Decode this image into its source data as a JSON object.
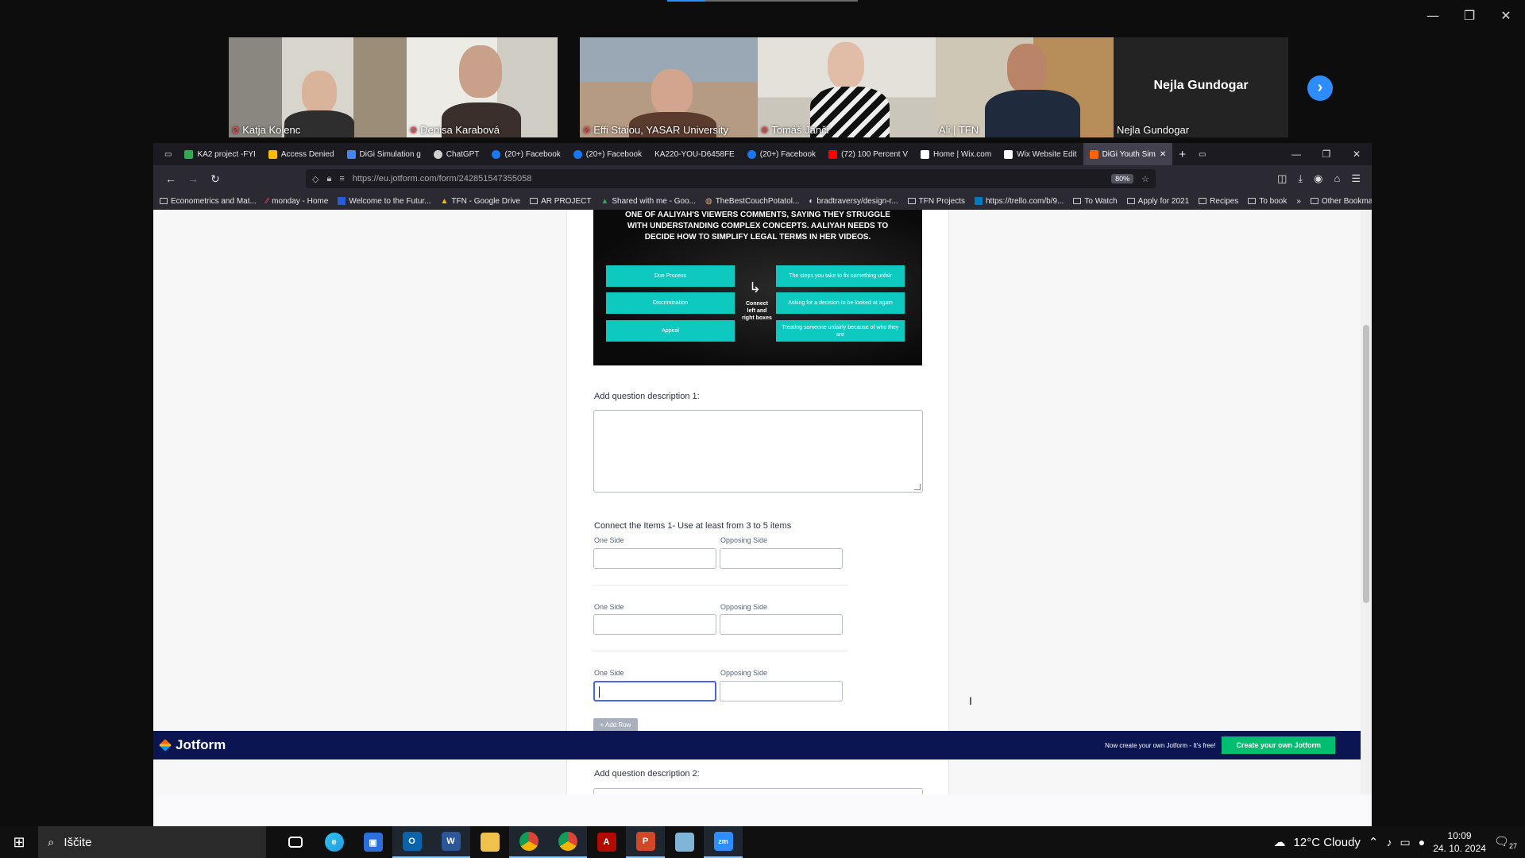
{
  "zoom": {
    "participants": [
      {
        "name": "Katja Kolenc",
        "muted": true
      },
      {
        "name": "Denisa Karabová",
        "muted": true
      },
      {
        "name": "Effi Staiou, YASAR University",
        "muted": true
      },
      {
        "name": "Tomáš Janči",
        "muted": true
      },
      {
        "name": "Ali | TFN",
        "muted": false,
        "active_speaker": true
      }
    ],
    "no_video_participant": {
      "display_name": "Nejla Gundogar",
      "label": "Nejla Gundogar"
    },
    "window_controls": {
      "minimize": "—",
      "restore": "❐",
      "close": "✕"
    }
  },
  "browser": {
    "tabs": [
      {
        "label": "KA2 project -FYI",
        "icon": "drive-icon",
        "color": "#34a853"
      },
      {
        "label": "Access Denied",
        "icon": "drive-icon",
        "color": "#fbbc04"
      },
      {
        "label": "DiGi Simulation g",
        "icon": "drive-icon",
        "color": "#4285f4"
      },
      {
        "label": "ChatGPT",
        "icon": "chatgpt-icon",
        "color": "#cfcfcf"
      },
      {
        "label": "(20+) Facebook",
        "icon": "facebook-icon",
        "color": "#1877f2"
      },
      {
        "label": "(20+) Facebook",
        "icon": "facebook-icon",
        "color": "#1877f2"
      },
      {
        "label": "KA220-YOU-D6458FE",
        "icon": "page-icon",
        "color": "#555555"
      },
      {
        "label": "(20+) Facebook",
        "icon": "facebook-icon",
        "color": "#1877f2"
      },
      {
        "label": "(72) 100 Percent V",
        "icon": "youtube-icon",
        "color": "#ff0000"
      },
      {
        "label": "Home | Wix.com",
        "icon": "wix-icon",
        "color": "#ffffff"
      },
      {
        "label": "Wix Website Edit",
        "icon": "wix-icon",
        "color": "#ffffff"
      },
      {
        "label": "DiGi Youth Sim",
        "icon": "jotform-icon",
        "color": "#ff6100",
        "active": true
      }
    ],
    "url": "https://eu.jotform.com/form/242851547355058",
    "zoom_level": "80%",
    "bookmarks": [
      "Econometrics and Mat...",
      "monday - Home",
      "Welcome to the Futur...",
      "TFN - Google Drive",
      "AR PROJECT",
      "Shared with me - Goo...",
      "TheBestCouchPotatol...",
      "bradtraversy/design-r...",
      "TFN Projects",
      "https://trello.com/b/9...",
      "To Watch",
      "Apply for 2021",
      "Recipes",
      "To book"
    ],
    "other_bookmarks": "Other Bookmarks"
  },
  "form": {
    "hero": {
      "text": "ONE OF AALIYAH'S VIEWERS COMMENTS, SAYING THEY STRUGGLE WITH UNDERSTANDING COMPLEX CONCEPTS. AALIYAH NEEDS TO DECIDE HOW TO SIMPLIFY LEGAL TERMS IN HER VIDEOS.",
      "left": [
        "Due Process",
        "Discrimination",
        "Appeal"
      ],
      "right": [
        "The steps you take to fix something unfair",
        "Asking for a decision to be looked at again",
        "Treating someone unfairly because of who they are"
      ],
      "connect_label": "Connect left and right boxes"
    },
    "desc1_label": "Add question description 1:",
    "matching_title": "Connect the Items 1- Use at least from 3 to 5 items",
    "one_side": "One Side",
    "opposing_side": "Opposing Side",
    "add_row": "+ Add Row",
    "desc2_label": "Add question description 2:"
  },
  "jotform_bar": {
    "logo": "Jotform",
    "promo": "Now create your own Jotform - It's free!",
    "cta": "Create your own Jotform"
  },
  "taskbar": {
    "search_placeholder": "Iščite",
    "weather": "12°C  Cloudy",
    "time": "10:09",
    "date": "24. 10. 2024",
    "notifications": "27"
  }
}
